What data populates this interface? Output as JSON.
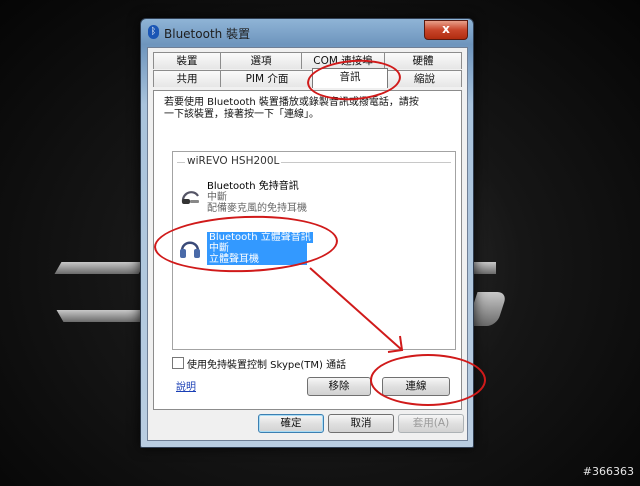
{
  "window": {
    "title": "Bluetooth 裝置",
    "close_glyph": "x"
  },
  "tabs": {
    "back_row": [
      "裝置",
      "選項",
      "COM 連接埠",
      "硬體"
    ],
    "front_row": [
      "共用",
      "PIM 介面",
      "音訊",
      "縮說"
    ],
    "active": "音訊"
  },
  "audio_tab": {
    "instruction_line1": "若要使用 Bluetooth 裝置播放或錄製音訊或撥電話，請按",
    "instruction_line2": "一下該裝置，接著按一下「連線」。",
    "group_name": "wiREVO HSH200L",
    "devices": [
      {
        "name": "Bluetooth 免持音訊",
        "status": "中斷",
        "description": "配備麥克風的免持耳機",
        "icon": "headset-icon",
        "selected": false
      },
      {
        "name": "Bluetooth 立體聲音訊",
        "status": "中斷",
        "description": "立體聲耳機",
        "icon": "headphones-icon",
        "selected": true
      }
    ],
    "skype_checkbox_label": "使用免持裝置控制 Skype(TM) 通話",
    "skype_checked": false,
    "help_link": "說明",
    "remove_button": "移除",
    "connect_button": "連線"
  },
  "footer": {
    "ok": "確定",
    "cancel": "取消",
    "apply": "套用(A)"
  },
  "watermark": "#366363",
  "colors": {
    "annotation": "#d01a1a",
    "selection": "#3399ff"
  }
}
